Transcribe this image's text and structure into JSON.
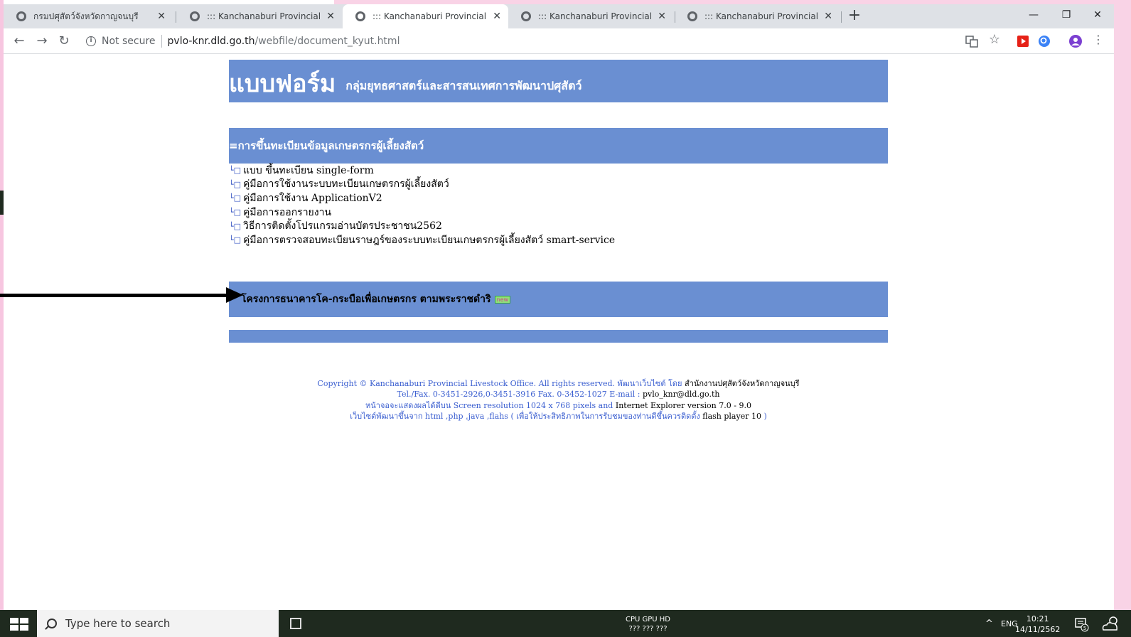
{
  "browser": {
    "tabs": [
      {
        "label": "กรมปศุสัตว์จังหวัดกาญจนบุรี",
        "close": "✕"
      },
      {
        "label": "::: Kanchanaburi Provincial Livesto",
        "close": "✕"
      },
      {
        "label": "::: Kanchanaburi Provincial Livesto",
        "close": "✕"
      },
      {
        "label": "::: Kanchanaburi Provincial Livesto",
        "close": "✕"
      },
      {
        "label": "::: Kanchanaburi Provincial Livesto",
        "close": "✕"
      }
    ],
    "new_tab": "+",
    "window_controls": {
      "minimize": "—",
      "restore": "❐",
      "close": "✕"
    },
    "nav": {
      "back": "←",
      "forward": "→",
      "reload": "↻"
    },
    "address": {
      "info": "i",
      "not_secure": "Not secure",
      "host": "pvlo-knr.dld.go.th",
      "path": "/webfile/document_kyut.html"
    },
    "menu": "⋮",
    "star": "☆"
  },
  "page": {
    "banner_title": "แบบฟอร์ม",
    "banner_subtitle": "กลุ่มยุทธศาสตร์และสารสนเทศการพัฒนาปศุสัตว์",
    "section1_title": "≡การขึ้นทะเบียนข้อมูลเกษตรกรผู้เลี้ยงสัตว์",
    "bullet": "└□",
    "links": [
      "แบบ ขึ้นทะเบียน single-form",
      "คู่มือการใช้งานระบบทะเบียนเกษตรกรผู้เลี้ยงสัตว์",
      "คู่มือการใช้งาน ApplicationV2",
      "คู่มือการออกรายงาน",
      "วิธีการติดตั้งโปรแกรมอ่านบัตรประชาชน2562",
      "คู่มือการตรวจสอบทะเบียนราษฎร์ของระบบทะเบียนเกษตรกรผู้เลี้ยงสัตว์ smart-service"
    ],
    "section2_title": "โครงการธนาคารโค-กระบือเพื่อเกษตรกร ตามพระราชดำริ",
    "new_badge": "new",
    "footer": {
      "line1_a": "Copyright © Kanchanaburi Provincial Livestock Office. All rights reserved. พัฒนาเว็บไซต์ โดย ",
      "line1_b": "สำนักงานปศุสัตว์จังหวัดกาญจนบุรี",
      "line2_a": "Tel./Fax. 0-3451-2926,0-3451-3916  Fax. 0-3452-1027 E-mail : ",
      "line2_b": "pvlo_knr@dld.go.th",
      "line3_a": "หน้าจอจะแสดงผลได้ดีบน Screen resolution 1024 x 768 pixels and ",
      "line3_b": "Internet Explorer version 7.0 - 9.0",
      "line4_a": "เว็บไซต์พัฒนาขึ้นจาก html ,php ,java ,flahs ( เพื่อให้ประสิทธิภาพในการรับชมของท่านดีขึ้นควรติดตั้ง ",
      "line4_b": "flash player 10",
      "line4_c": " )"
    }
  },
  "taskbar": {
    "search_placeholder": "Type here to search",
    "perf_label": "CPU GPU HD",
    "perf_values": "???  ???  ???",
    "tray_chevron": "^",
    "lang": "ENG",
    "time": "10:21",
    "date": "14/11/2562",
    "notif_count": "5"
  },
  "colors": {
    "banner": "#6a8fd2",
    "footer_text": "#3b5fd0",
    "taskbar": "#1f2a1f"
  }
}
